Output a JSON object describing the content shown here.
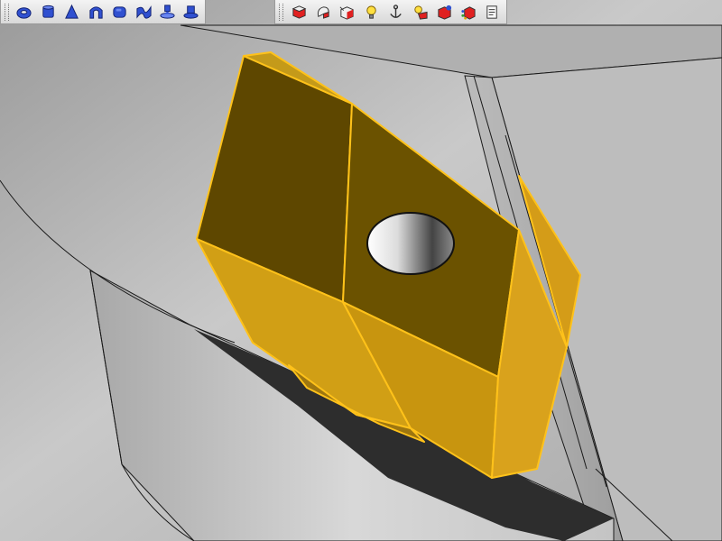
{
  "toolbars": {
    "shape_tools": [
      {
        "icon": "torus-icon",
        "tooltip": ""
      },
      {
        "icon": "cylinder-icon",
        "tooltip": ""
      },
      {
        "icon": "cone-icon",
        "tooltip": ""
      },
      {
        "icon": "arch-icon",
        "tooltip": ""
      },
      {
        "icon": "rounded-box-icon",
        "tooltip": ""
      },
      {
        "icon": "loft-surface-icon",
        "tooltip": ""
      },
      {
        "icon": "extrude-icon",
        "tooltip": ""
      },
      {
        "icon": "revolve-icon",
        "tooltip": ""
      }
    ],
    "view_tools": [
      {
        "icon": "shaded-view-icon",
        "tooltip": ""
      },
      {
        "icon": "wireframe-view-icon",
        "tooltip": ""
      },
      {
        "icon": "hidden-line-view-icon",
        "tooltip": ""
      },
      {
        "icon": "light-bulb-icon",
        "tooltip": ""
      },
      {
        "icon": "anchor-icon",
        "tooltip": ""
      },
      {
        "icon": "ambient-light-icon",
        "tooltip": ""
      },
      {
        "icon": "material-icon",
        "tooltip": ""
      },
      {
        "icon": "texture-icon",
        "tooltip": ""
      },
      {
        "icon": "properties-icon",
        "tooltip": ""
      }
    ]
  },
  "scene": {
    "background_color": "#b4b4b4",
    "selected_part_color": "#d9a21c",
    "selection_edge_color": "#ffc21a",
    "shadow_color": "#2d2d2d"
  }
}
